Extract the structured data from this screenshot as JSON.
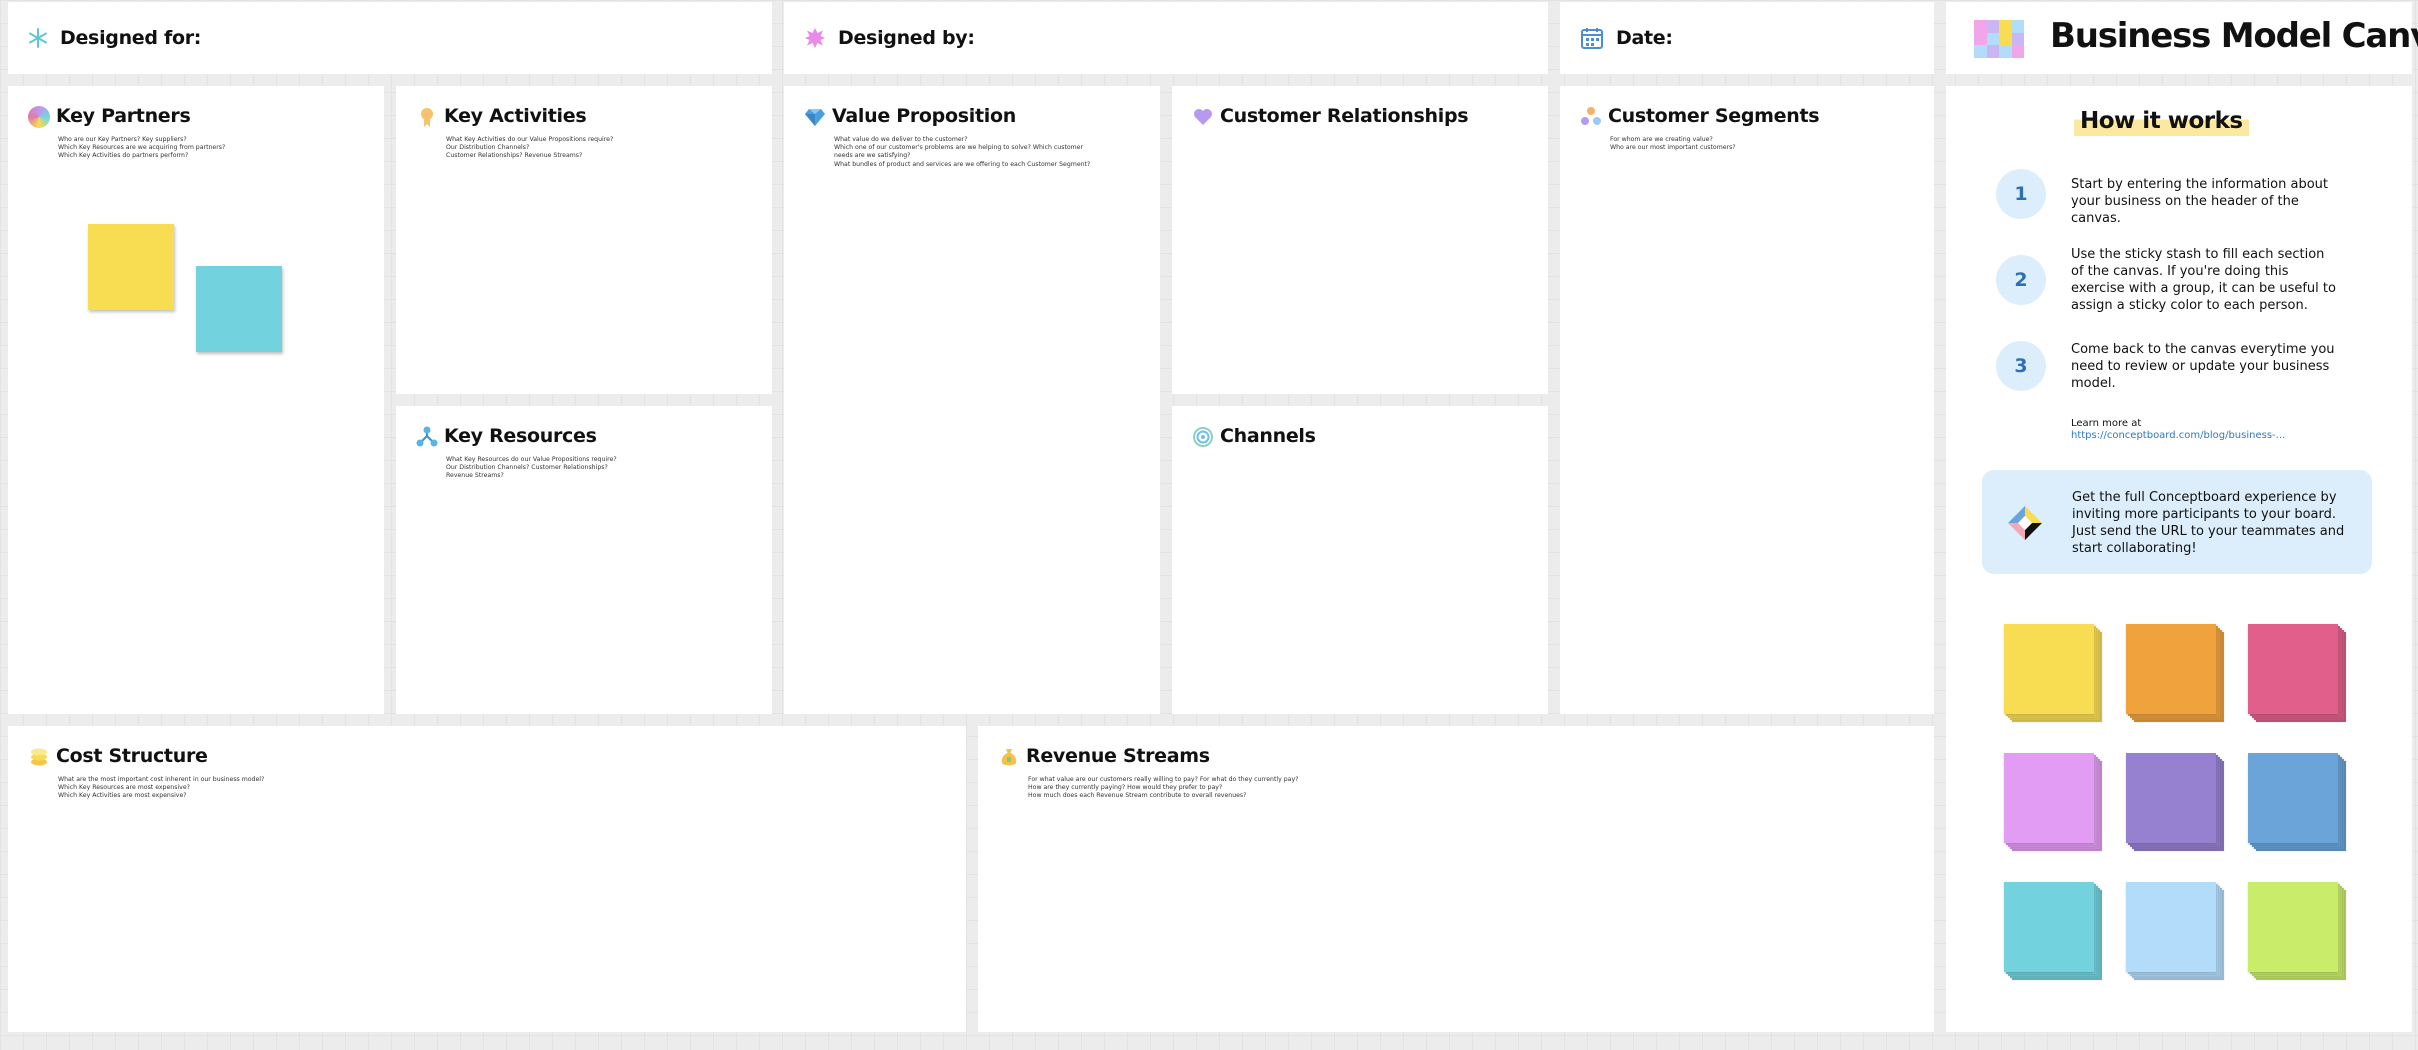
{
  "header": {
    "designed_for": "Designed for:",
    "designed_by": "Designed by:",
    "date": "Date:",
    "title": "Business Model Canvas"
  },
  "sections": {
    "key_partners": {
      "title": "Key Partners",
      "questions": [
        "Who are our Key Partners? Key suppliers?",
        "Which Key Resources are we acquiring from partners?",
        "Which Key Activities do partners perform?"
      ]
    },
    "key_activities": {
      "title": "Key Activities",
      "questions": [
        "What Key Activities do our Value Propositions require?",
        "Our Distribution Channels?",
        "Customer Relationships? Revenue Streams?"
      ]
    },
    "key_resources": {
      "title": "Key Resources",
      "questions": [
        "What Key Resources do our Value Propositions require?",
        "Our Distribution Channels? Customer Relationships?",
        "Revenue Streams?"
      ]
    },
    "value_proposition": {
      "title": "Value Proposition",
      "questions": [
        "What value do we deliver to the customer?",
        "Which one of our customer's problems are we helping to solve? Which customer",
        "needs are we satisfying?",
        "What bundles of product and services are we offering to each Customer Segment?"
      ]
    },
    "customer_relationships": {
      "title": "Customer Relationships"
    },
    "channels": {
      "title": "Channels"
    },
    "customer_segments": {
      "title": "Customer Segments",
      "questions": [
        "For whom are we creating value?",
        "Who are our most important customers?"
      ]
    },
    "cost_structure": {
      "title": "Cost Structure",
      "questions": [
        "What are the most important cost inherent in our business model?",
        "Which Key Resources are most expensive?",
        "Which Key Activities are most expensive?"
      ]
    },
    "revenue_streams": {
      "title": "Revenue Streams",
      "questions": [
        "For what value are our customers really willing to pay? For what do they currently pay?",
        "How are they currently paying? How would they prefer to pay?",
        "How much does each Revenue Stream contribute to overall revenues?"
      ]
    }
  },
  "how_it_works": {
    "title": "How it works",
    "steps": [
      {
        "num": "1",
        "text": "Start by entering the information about your business on the header of the canvas."
      },
      {
        "num": "2",
        "text": "Use the sticky stash to fill each section of the canvas. If you're doing this exercise with a group, it can be useful to assign a sticky color to each person."
      },
      {
        "num": "3",
        "text": "Come back to the canvas everytime you need to review or update your business model."
      }
    ],
    "learn_more": "Learn more at",
    "link": "https://conceptboard.com/blog/business-..."
  },
  "promo": {
    "text": "Get the full Conceptboard experience by inviting more participants to your board. Just send the URL to your teammates and start collaborating!"
  },
  "sticky_stash_colors": [
    "#f8dd52",
    "#f0a23d",
    "#e0608b",
    "#e29cf3",
    "#9581cf",
    "#6aa4d8",
    "#72d3df",
    "#b3dcfb",
    "#c9ec6b"
  ],
  "sticky_notes": [
    {
      "color": "#f8dd52",
      "area": "key_partners"
    },
    {
      "color": "#72d3df",
      "area": "key_partners"
    }
  ],
  "colors": {
    "accent_blue": "#2f6fb3",
    "link": "#2e79c4",
    "promo_bg": "#dceefc",
    "title_highlight": "#fbe9a0"
  }
}
